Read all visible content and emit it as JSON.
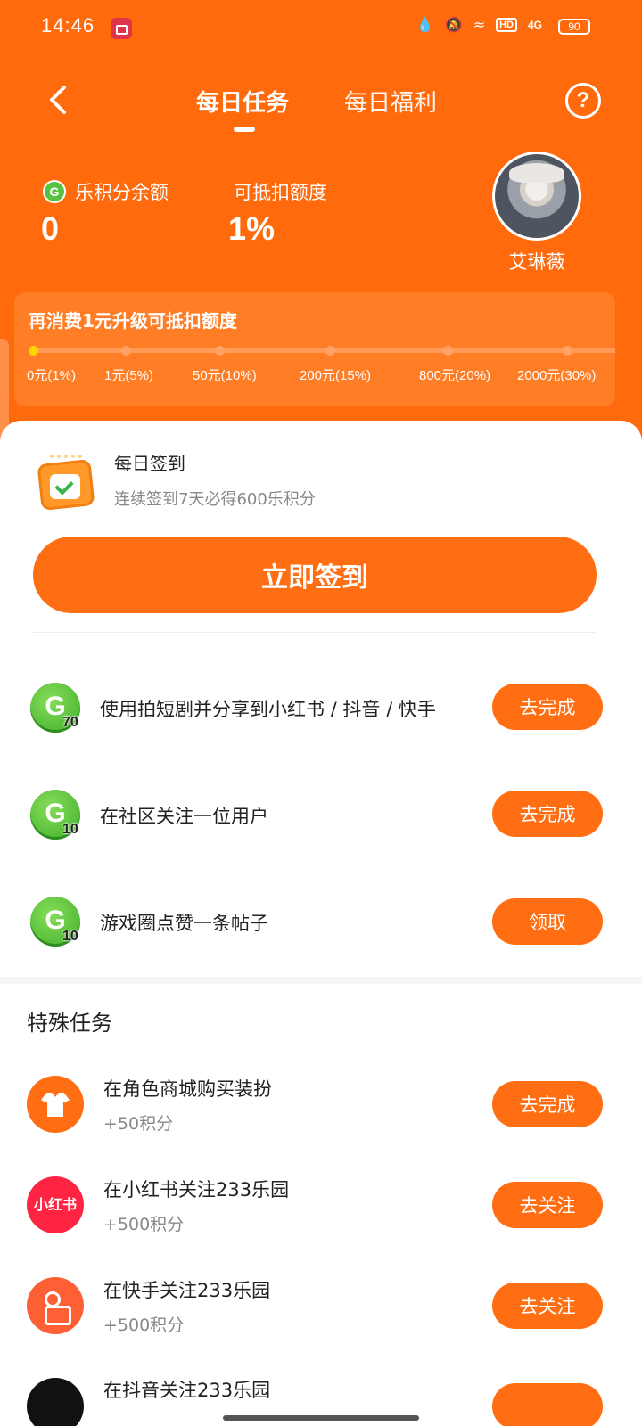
{
  "status_bar": {
    "time": "14:46",
    "hd": "HD",
    "network": "4G",
    "battery": "90"
  },
  "header": {
    "tabs": [
      {
        "label": "每日任务",
        "active": true
      },
      {
        "label": "每日福利",
        "active": false
      }
    ],
    "help_label": "?"
  },
  "account": {
    "points_label": "乐积分余额",
    "points_value": "0",
    "deduct_label": "可抵扣额度",
    "deduct_value": "1%",
    "user_name": "艾琳薇"
  },
  "progress": {
    "title": "再消费1元升级可抵扣额度",
    "current_index": 0,
    "levels": [
      "0元(1%)",
      "1元(5%)",
      "50元(10%)",
      "200元(15%)",
      "800元(20%)",
      "2000元(30%)"
    ]
  },
  "sign_in": {
    "title": "每日签到",
    "subtitle": "连续签到7天必得600乐积分",
    "button": "立即签到"
  },
  "daily_tasks": [
    {
      "points": "70",
      "label": "使用拍短剧并分享到小红书 / 抖音 / 快手",
      "action": "去完成"
    },
    {
      "points": "10",
      "label": "在社区关注一位用户",
      "action": "去完成"
    },
    {
      "points": "10",
      "label": "游戏圈点赞一条帖子",
      "action": "领取"
    }
  ],
  "special": {
    "title": "特殊任务",
    "tasks": [
      {
        "icon": "shirt-icon",
        "name": "在角色商城购买装扮",
        "points": "+50积分",
        "action": "去完成"
      },
      {
        "icon": "xiaohongshu-icon",
        "icon_text": "小红书",
        "name": "在小红书关注233乐园",
        "points": "+500积分",
        "action": "去关注"
      },
      {
        "icon": "kuaishou-icon",
        "name": "在快手关注233乐园",
        "points": "+500积分",
        "action": "去关注"
      },
      {
        "icon": "douyin-icon",
        "name": "在抖音关注233乐园"
      }
    ]
  },
  "colors": {
    "brand_orange": "#ff6a0d",
    "button_orange": "#ff6e12",
    "points_green": "#3fae2b",
    "xiaohongshu_red": "#ff2442"
  }
}
